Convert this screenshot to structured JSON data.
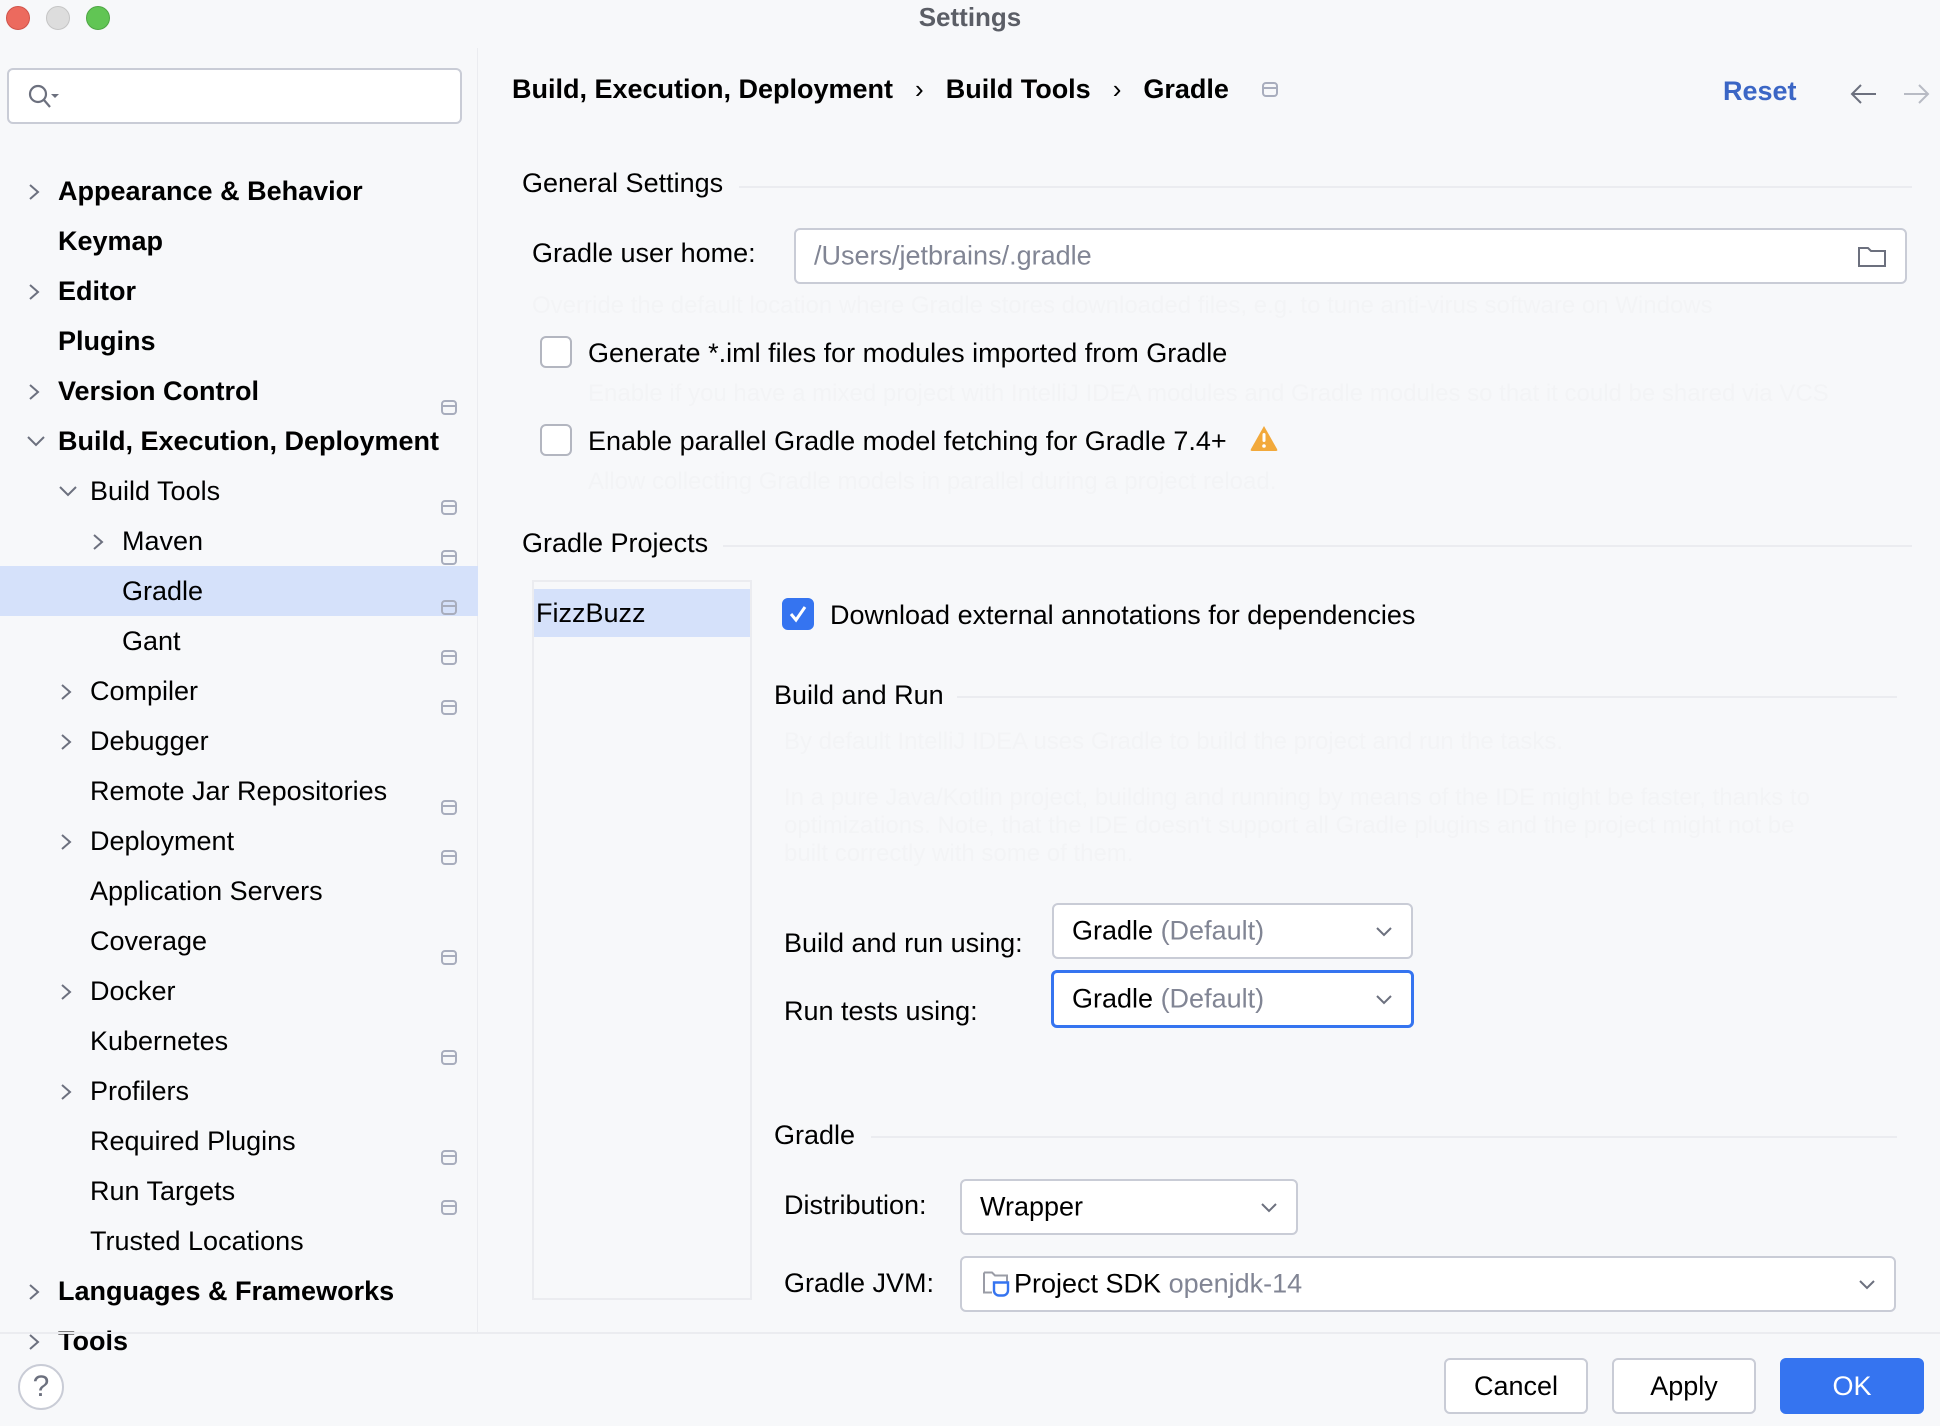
{
  "window": {
    "title": "Settings"
  },
  "search": {
    "value": "",
    "placeholder": ""
  },
  "sidebar": {
    "items": [
      {
        "label": "Appearance & Behavior",
        "level": 0,
        "bold": true,
        "expander": "collapsed",
        "project_icon": false
      },
      {
        "label": "Keymap",
        "level": 0,
        "bold": true,
        "expander": "none",
        "project_icon": false
      },
      {
        "label": "Editor",
        "level": 0,
        "bold": true,
        "expander": "collapsed",
        "project_icon": false
      },
      {
        "label": "Plugins",
        "level": 0,
        "bold": true,
        "expander": "none",
        "project_icon": false
      },
      {
        "label": "Version Control",
        "level": 0,
        "bold": true,
        "expander": "collapsed",
        "project_icon": true
      },
      {
        "label": "Build, Execution, Deployment",
        "level": 0,
        "bold": true,
        "expander": "expanded",
        "project_icon": false
      },
      {
        "label": "Build Tools",
        "level": 1,
        "bold": false,
        "expander": "expanded",
        "project_icon": true
      },
      {
        "label": "Maven",
        "level": 2,
        "bold": false,
        "expander": "collapsed",
        "project_icon": true
      },
      {
        "label": "Gradle",
        "level": 2,
        "bold": false,
        "expander": "none",
        "project_icon": true,
        "selected": true
      },
      {
        "label": "Gant",
        "level": 2,
        "bold": false,
        "expander": "none",
        "project_icon": true
      },
      {
        "label": "Compiler",
        "level": 1,
        "bold": false,
        "expander": "collapsed",
        "project_icon": true
      },
      {
        "label": "Debugger",
        "level": 1,
        "bold": false,
        "expander": "collapsed",
        "project_icon": false
      },
      {
        "label": "Remote Jar Repositories",
        "level": 1,
        "bold": false,
        "expander": "none",
        "project_icon": true
      },
      {
        "label": "Deployment",
        "level": 1,
        "bold": false,
        "expander": "collapsed",
        "project_icon": true
      },
      {
        "label": "Application Servers",
        "level": 1,
        "bold": false,
        "expander": "none",
        "project_icon": false
      },
      {
        "label": "Coverage",
        "level": 1,
        "bold": false,
        "expander": "none",
        "project_icon": true
      },
      {
        "label": "Docker",
        "level": 1,
        "bold": false,
        "expander": "collapsed",
        "project_icon": false
      },
      {
        "label": "Kubernetes",
        "level": 1,
        "bold": false,
        "expander": "none",
        "project_icon": true
      },
      {
        "label": "Profilers",
        "level": 1,
        "bold": false,
        "expander": "collapsed",
        "project_icon": false
      },
      {
        "label": "Required Plugins",
        "level": 1,
        "bold": false,
        "expander": "none",
        "project_icon": true
      },
      {
        "label": "Run Targets",
        "level": 1,
        "bold": false,
        "expander": "none",
        "project_icon": true
      },
      {
        "label": "Trusted Locations",
        "level": 1,
        "bold": false,
        "expander": "none",
        "project_icon": false
      },
      {
        "label": "Languages & Frameworks",
        "level": 0,
        "bold": true,
        "expander": "collapsed",
        "project_icon": false
      },
      {
        "label": "Tools",
        "level": 0,
        "bold": true,
        "expander": "collapsed",
        "project_icon": false
      }
    ]
  },
  "header": {
    "breadcrumbs": [
      "Build, Execution, Deployment",
      "Build Tools",
      "Gradle"
    ],
    "separator": "›",
    "reset_label": "Reset"
  },
  "general": {
    "title": "General Settings",
    "user_home_label": "Gradle user home:",
    "user_home_value": "/Users/jetbrains/.gradle",
    "user_home_hint": "Override the default location where Gradle stores downloaded files, e.g. to tune anti-virus software on Windows",
    "gen_iml_label": "Generate *.iml files for modules imported from Gradle",
    "gen_iml_checked": false,
    "gen_iml_hint": "Enable if you have a mixed project with IntelliJ IDEA modules and Gradle modules so that it could be shared via VCS",
    "parallel_label": "Enable parallel Gradle model fetching for Gradle 7.4+",
    "parallel_checked": false,
    "parallel_hint": "Allow collecting Gradle models in parallel during a project reload."
  },
  "projects": {
    "title": "Gradle Projects",
    "list": [
      "FizzBuzz"
    ],
    "selected": "FizzBuzz",
    "download_annotations_label": "Download external annotations for dependencies",
    "download_annotations_checked": true,
    "build_run": {
      "title": "Build and Run",
      "hint1": "By default IntelliJ IDEA uses Gradle to build the project and run the tasks.",
      "hint2": "In a pure Java/Kotlin project, building and running by means of the IDE might be faster, thanks to optimizations. Note, that the IDE doesn't support all Gradle plugins and the project might not be built correctly with some of them.",
      "build_using_label": "Build and run using:",
      "build_using_value": "Gradle",
      "build_using_suffix": "(Default)",
      "tests_using_label": "Run tests using:",
      "tests_using_value": "Gradle",
      "tests_using_suffix": "(Default)"
    },
    "gradle": {
      "title": "Gradle",
      "distribution_label": "Distribution:",
      "distribution_value": "Wrapper",
      "jvm_label": "Gradle JVM:",
      "jvm_value": "Project SDK",
      "jvm_suffix": "openjdk-14"
    }
  },
  "footer": {
    "help": "?",
    "cancel": "Cancel",
    "apply": "Apply",
    "ok": "OK"
  },
  "colors": {
    "accent": "#3574f0",
    "link": "#3b66c5",
    "selection": "#d5e1fa",
    "warning": "#f2a93b"
  }
}
